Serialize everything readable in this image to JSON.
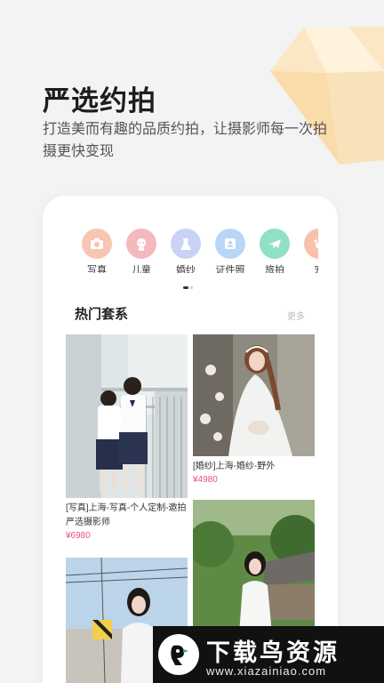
{
  "hero": {
    "title": "严选约拍",
    "subtitle": "打造美而有趣的品质约拍，让摄影师每一次拍摄更快变现"
  },
  "categories": [
    {
      "label": "写真",
      "icon": "camera-icon",
      "color": "#f6c6b3"
    },
    {
      "label": "儿童",
      "icon": "child-icon",
      "color": "#f4b9bd"
    },
    {
      "label": "婚纱",
      "icon": "wedding-dress-icon",
      "color": "#c8d3f5"
    },
    {
      "label": "证件照",
      "icon": "id-card-icon",
      "color": "#b9d6f6"
    },
    {
      "label": "旅拍",
      "icon": "airplane-icon",
      "color": "#8fe0c5"
    },
    {
      "label": "宠",
      "icon": "pet-icon",
      "color": "#f7c2a9"
    }
  ],
  "section": {
    "title": "热门套系",
    "more": "更多"
  },
  "packages": [
    {
      "title": "[写真]上海-写真-个人定制-邀拍严选摄影师",
      "price": "¥6980"
    },
    {
      "title": "[婚纱]上海-婚纱-野外",
      "price": "¥4980"
    }
  ],
  "watermark": {
    "name": "下载鸟资源",
    "url": "www.xiazainiao.com"
  }
}
